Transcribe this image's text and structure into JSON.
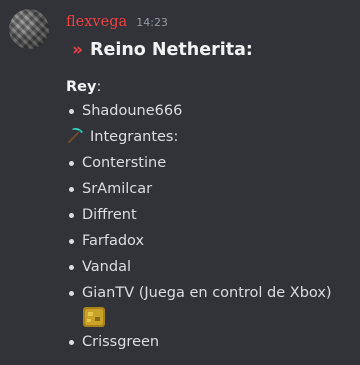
{
  "message": {
    "author": "flexvega",
    "timestamp": "14:23",
    "heading": "Reino Netherita:",
    "heading_marker": "»",
    "section_rey_label": "Rey",
    "section_rey_suffix": ":",
    "rey_members": [
      "Shadoune666"
    ],
    "integrantes_label": "Integrantes:",
    "integrantes_icon": "pickaxe-icon",
    "members": [
      "Conterstine",
      "SrAmilcar",
      "Diffrent",
      "Farfadox",
      "Vandal",
      "GianTV (Juega en control de Xbox)",
      "Crissgreen"
    ],
    "member_emoji": "gold-block-emoji"
  },
  "colors": {
    "background": "#313338",
    "username": "#f23f43",
    "text": "#dbdee1",
    "accent_marker": "#ed4245"
  }
}
